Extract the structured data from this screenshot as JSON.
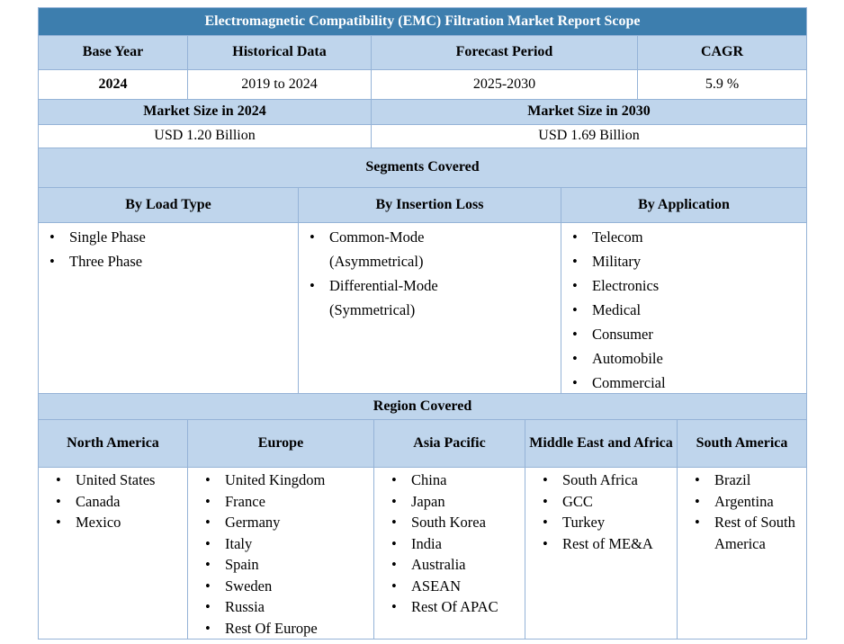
{
  "colors": {
    "title_bg": "#3D7EAE",
    "header_bg": "#BFD5EC",
    "border": "#95B3D7",
    "title_text": "#FFFFFF"
  },
  "icons": {
    "bullet": "•"
  },
  "table": {
    "title": "Electromagnetic Compatibility (EMC) Filtration Market Report Scope",
    "overview": {
      "headers": [
        "Base Year",
        "Historical Data",
        "Forecast Period",
        "CAGR"
      ],
      "values": [
        "2024",
        "2019 to 2024",
        "2025-2030",
        "5.9 %"
      ]
    },
    "market_size": {
      "headers": [
        "Market Size in 2024",
        "Market Size in 2030"
      ],
      "values": [
        "USD 1.20 Billion",
        "USD 1.69 Billion"
      ]
    },
    "segments": {
      "section_title": "Segments Covered",
      "columns": [
        {
          "header": "By Load Type",
          "items": [
            "Single Phase",
            "Three Phase"
          ]
        },
        {
          "header": "By Insertion Loss",
          "items": [
            "Common-Mode\n(Asymmetrical)",
            "Differential-Mode\n(Symmetrical)"
          ]
        },
        {
          "header": "By Application",
          "items": [
            "Telecom",
            "Military",
            "Electronics",
            "Medical",
            "Consumer",
            "Automobile",
            "Commercial"
          ]
        }
      ]
    },
    "regions": {
      "section_title": "Region Covered",
      "columns": [
        {
          "header": "North America",
          "items": [
            "United States",
            "Canada",
            "Mexico"
          ]
        },
        {
          "header": "Europe",
          "items": [
            "United Kingdom",
            "France",
            "Germany",
            "Italy",
            "Spain",
            "Sweden",
            "Russia",
            "Rest Of Europe"
          ]
        },
        {
          "header": "Asia Pacific",
          "items": [
            "China",
            "Japan",
            "South Korea",
            "India",
            "Australia",
            "ASEAN",
            "Rest Of APAC"
          ]
        },
        {
          "header": "Middle East and Africa",
          "items": [
            "South Africa",
            "GCC",
            "Turkey",
            "Rest of ME&A"
          ]
        },
        {
          "header": "South America",
          "items": [
            "Brazil",
            "Argentina",
            "Rest of South\nAmerica"
          ]
        }
      ]
    }
  }
}
